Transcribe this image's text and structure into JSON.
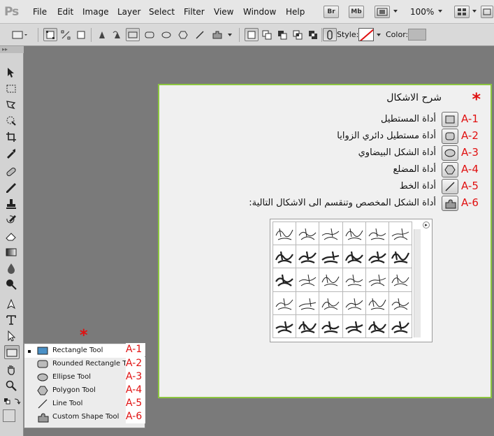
{
  "app": {
    "logo": "Ps"
  },
  "menubar": {
    "items": [
      "File",
      "Edit",
      "Image",
      "Layer",
      "Select",
      "Filter",
      "View",
      "Window",
      "Help"
    ],
    "bridge": "Br",
    "minibridge": "Mb",
    "zoom": "100%"
  },
  "options": {
    "style_label": "Style:",
    "color_label": "Color:"
  },
  "flyout": {
    "marker": "*",
    "items": [
      {
        "tag": "A-1",
        "label": "Rectangle Tool"
      },
      {
        "tag": "A-2",
        "label": "Rounded Rectangle Tool"
      },
      {
        "tag": "A-3",
        "label": "Ellipse Tool"
      },
      {
        "tag": "A-4",
        "label": "Polygon Tool"
      },
      {
        "tag": "A-5",
        "label": "Line Tool"
      },
      {
        "tag": "A-6",
        "label": "Custom Shape Tool"
      }
    ]
  },
  "explanation": {
    "marker": "*",
    "title": "شرح الاشكال",
    "rows": [
      {
        "tag": "A-1",
        "text": "أداة المستطيل"
      },
      {
        "tag": "A-2",
        "text": "أداة مستطيل دائري الزوايا"
      },
      {
        "tag": "A-3",
        "text": "أداة الشكل البيضاوي"
      },
      {
        "tag": "A-4",
        "text": "أداة المضلع"
      },
      {
        "tag": "A-5",
        "text": "أداة الخط"
      },
      {
        "tag": "A-6",
        "text": "أداة الشكل المخصص وتنقسم الى الاشكال التالية:"
      }
    ]
  },
  "shape_picker": {
    "menu_icon": "flyout-menu-icon",
    "cells": 30
  },
  "colors": {
    "accent_border": "#8cc63f",
    "tag_red": "#e01010"
  }
}
